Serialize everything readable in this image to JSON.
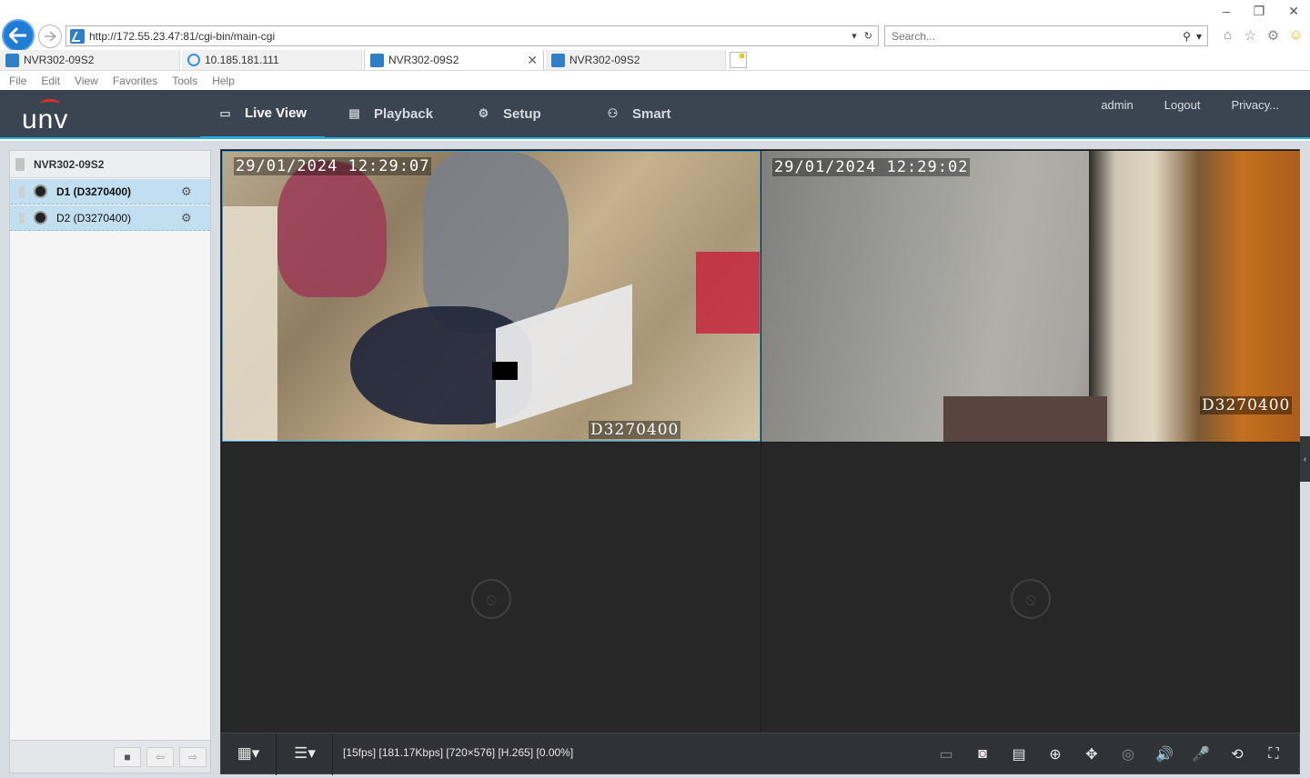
{
  "browser": {
    "url": "http://172.55.23.47:81/cgi-bin/main-cgi",
    "search_placeholder": "Search...",
    "tabs": [
      {
        "label": "NVR302-09S2"
      },
      {
        "label": "10.185.181.111"
      },
      {
        "label": "NVR302-09S2"
      },
      {
        "label": "NVR302-09S2"
      }
    ],
    "menu": [
      "File",
      "Edit",
      "View",
      "Favorites",
      "Tools",
      "Help"
    ]
  },
  "header": {
    "logo": "unv",
    "nav": [
      {
        "label": "Live View",
        "icon": "monitor-icon",
        "active": true
      },
      {
        "label": "Playback",
        "icon": "film-icon"
      },
      {
        "label": "Setup",
        "icon": "gear-icon"
      },
      {
        "label": "Smart",
        "icon": "person-icon"
      }
    ],
    "links": {
      "user": "admin",
      "logout": "Logout",
      "privacy": "Privacy..."
    }
  },
  "sidebar": {
    "device": "NVR302-09S2",
    "channels": [
      {
        "label": "D1 (D3270400)",
        "active": true
      },
      {
        "label": "D2 (D3270400)",
        "active": false
      }
    ]
  },
  "panes": [
    {
      "time": "29/01/2024 12:29:07",
      "name": "D3270400"
    },
    {
      "time": "29/01/2024 12:29:02",
      "name": "D3270400"
    }
  ],
  "toolbar": {
    "stream_info": "[15fps] [181.17Kbps] [720×576] [H.265] [0.00%]"
  },
  "colors": {
    "header_bg": "#3b4552",
    "accent": "#27a9e1",
    "sidebar_selected": "#c2dff1"
  }
}
